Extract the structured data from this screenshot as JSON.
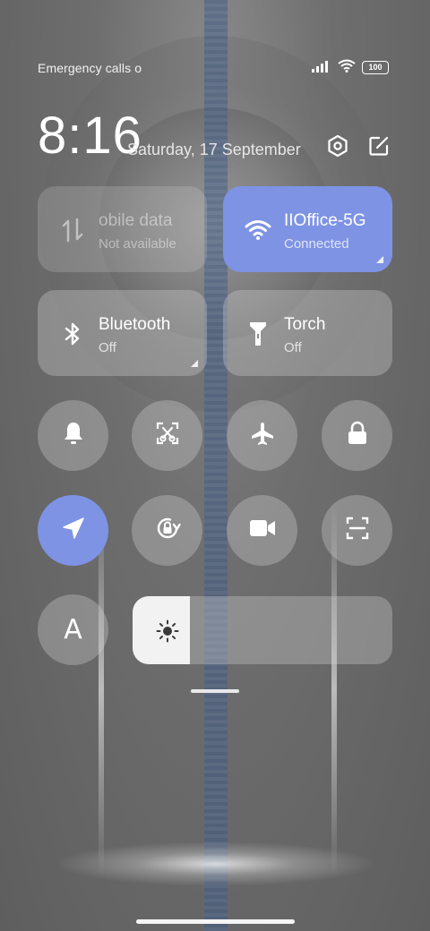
{
  "status_bar": {
    "carrier_text": "Emergency calls o",
    "battery": "100",
    "icons": [
      "signal-icon",
      "wifi-icon",
      "battery-icon"
    ]
  },
  "header": {
    "time": "8:16",
    "date": "Saturday, 17 September",
    "icons": [
      "settings-icon",
      "edit-icon"
    ]
  },
  "tiles": {
    "mobile_data": {
      "title": "obile data",
      "subtitle": "Not available",
      "state": "unavailable"
    },
    "wifi": {
      "title": "IIOffice-5G",
      "subtitle": "Connected",
      "state": "on"
    },
    "bluetooth": {
      "title": "Bluetooth",
      "subtitle": "Off",
      "state": "off"
    },
    "torch": {
      "title": "Torch",
      "subtitle": "Off",
      "state": "off"
    }
  },
  "toggles": [
    {
      "name": "sound",
      "icon": "bell-icon",
      "active": false
    },
    {
      "name": "screenshot",
      "icon": "scissors-icon",
      "active": false
    },
    {
      "name": "airplane-mode",
      "icon": "airplane-icon",
      "active": false
    },
    {
      "name": "lock-screen",
      "icon": "lock-icon",
      "active": false
    },
    {
      "name": "location",
      "icon": "location-arrow-icon",
      "active": true
    },
    {
      "name": "rotation-lock",
      "icon": "rotation-lock-icon",
      "active": false
    },
    {
      "name": "screen-recorder",
      "icon": "video-camera-icon",
      "active": false
    },
    {
      "name": "scanner",
      "icon": "scan-icon",
      "active": false
    }
  ],
  "auto_brightness": {
    "label": "A"
  },
  "brightness": {
    "level": 0.22,
    "icon": "sun-icon"
  },
  "colors": {
    "accent": "#7e93e4",
    "tile_bg": "rgba(215,215,215,0.32)"
  }
}
